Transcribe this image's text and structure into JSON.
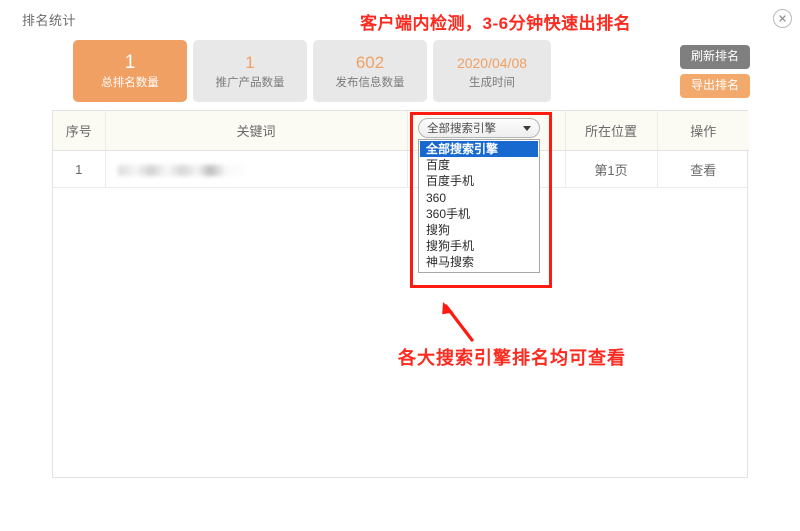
{
  "window": {
    "title": "排名统计",
    "close_icon": "close-circle-icon"
  },
  "annotations": {
    "top_note": "客户端内检测，3-6分钟快速出排名",
    "bottom_note": "各大搜索引擎排名均可查看",
    "highlight_color": "#fd1b10",
    "note_color": "#fd2a20",
    "arrow_icon": "arrow-up-left-icon"
  },
  "stats": [
    {
      "value": "1",
      "label": "总排名数量",
      "active": true
    },
    {
      "value": "1",
      "label": "推广产品数量",
      "active": false
    },
    {
      "value": "602",
      "label": "发布信息数量",
      "active": false
    },
    {
      "value": "2020/04/08",
      "label": "生成时间",
      "active": false
    }
  ],
  "buttons": {
    "refresh_label": "刷新排名",
    "export_label": "导出排名",
    "refresh_color": "#7f7f7f",
    "export_color": "#f3a86c"
  },
  "table": {
    "headers": {
      "index": "序号",
      "keyword": "关键词",
      "engine": "全部搜索引擎",
      "position": "所在位置",
      "action": "操作"
    },
    "rows": [
      {
        "index": "1",
        "keyword": "",
        "position": "第1页",
        "action": "查看"
      }
    ]
  },
  "engine_select": {
    "selected": "全部搜索引擎",
    "caret_icon": "chevron-down-icon",
    "options": [
      "全部搜索引擎",
      "百度",
      "百度手机",
      "360",
      "360手机",
      "搜狗",
      "搜狗手机",
      "神马搜索"
    ]
  },
  "colors": {
    "accent_orange": "#f0a062",
    "card_gray": "#e8e8e8",
    "table_header_bg": "#fbfaf3",
    "select_highlight": "#1769d0"
  }
}
